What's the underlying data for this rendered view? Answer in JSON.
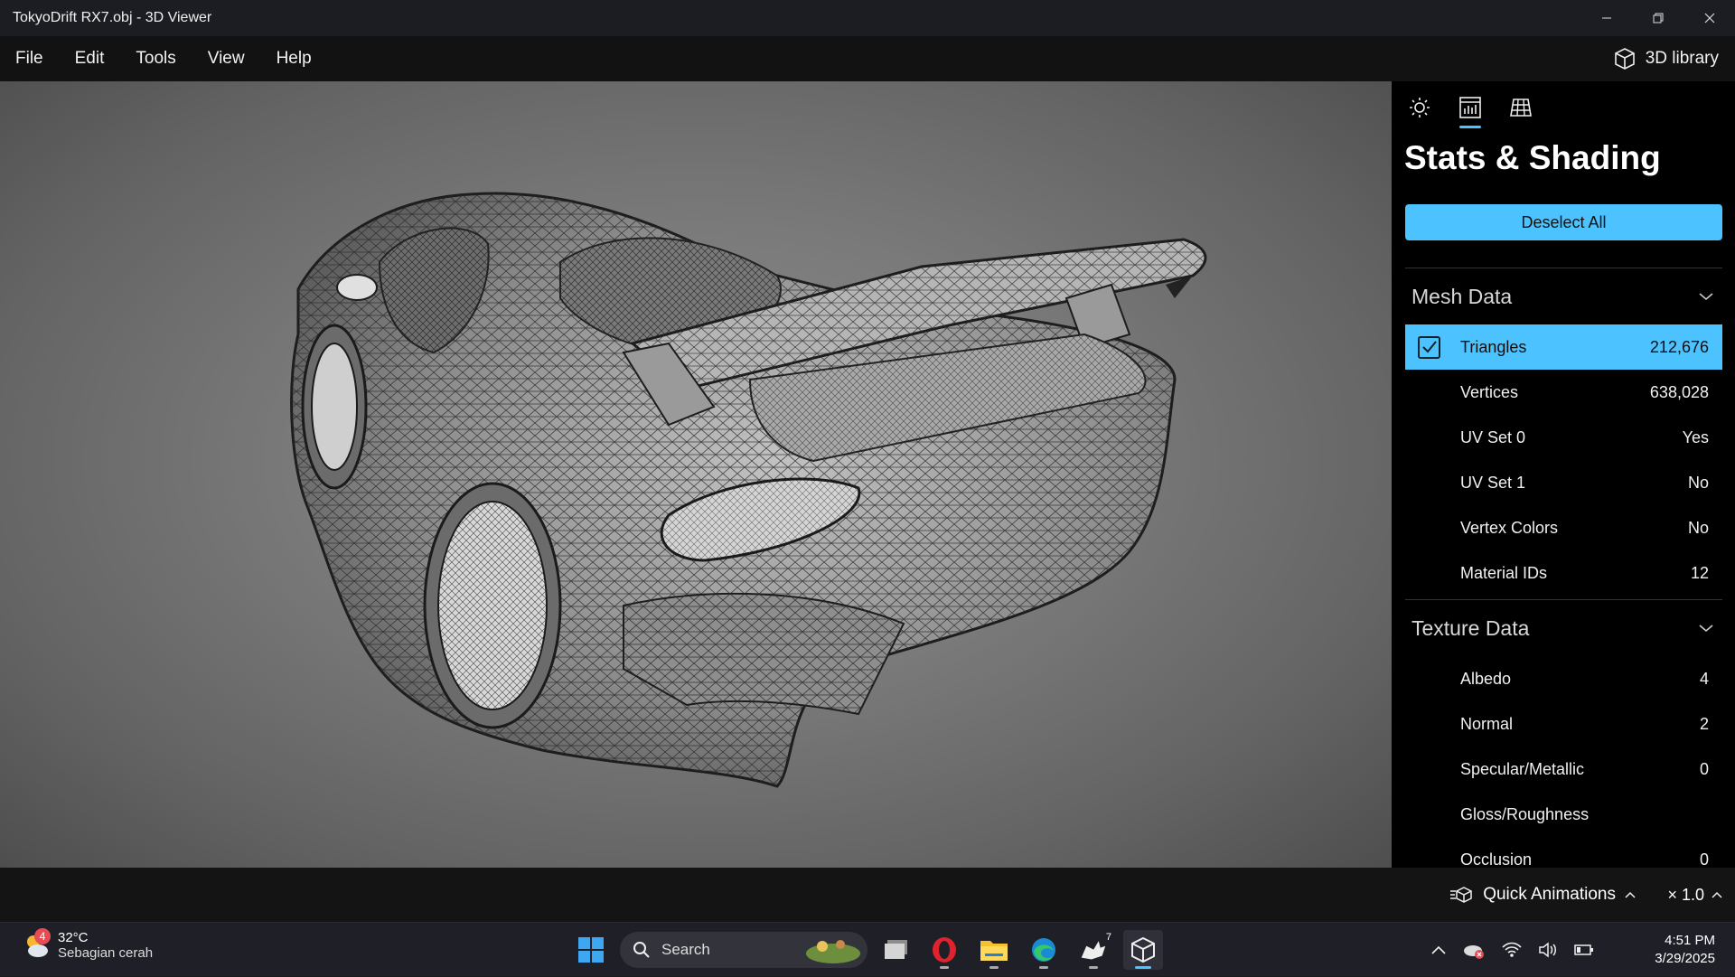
{
  "window": {
    "title": "TokyoDrift RX7.obj - 3D Viewer"
  },
  "menu": {
    "items": [
      "File",
      "Edit",
      "Tools",
      "View",
      "Help"
    ],
    "library_label": "3D library"
  },
  "panel": {
    "title": "Stats & Shading",
    "deselect_label": "Deselect All",
    "mesh_section": "Mesh Data",
    "mesh_rows": [
      {
        "label": "Triangles",
        "value": "212,676",
        "selected": true
      },
      {
        "label": "Vertices",
        "value": "638,028"
      },
      {
        "label": "UV Set 0",
        "value": "Yes"
      },
      {
        "label": "UV Set 1",
        "value": "No"
      },
      {
        "label": "Vertex Colors",
        "value": "No"
      },
      {
        "label": "Material IDs",
        "value": "12"
      }
    ],
    "texture_section": "Texture Data",
    "texture_rows": [
      {
        "label": "Albedo",
        "value": "4"
      },
      {
        "label": "Normal",
        "value": "2"
      },
      {
        "label": "Specular/Metallic",
        "value": "0"
      },
      {
        "label": "Gloss/Roughness",
        "value": ""
      },
      {
        "label": "Occlusion",
        "value": "0"
      }
    ]
  },
  "statusbar": {
    "quick_animations": "Quick Animations",
    "speed": "× 1.0"
  },
  "taskbar": {
    "weather_badge": "4",
    "temperature": "32°C",
    "weather_desc": "Sebagian cerah",
    "search_label": "Search",
    "time": "4:51 PM",
    "date": "3/29/2025",
    "rhino_badge": "7"
  },
  "colors": {
    "accent": "#4cc2ff",
    "panel_bg": "#000000",
    "titlebar_bg": "#1c1d22"
  },
  "icons": {
    "lighting_tab": "sun-icon",
    "stats_tab": "stats-chart-icon",
    "grid_tab": "grid-icon",
    "library": "cube-icon"
  }
}
